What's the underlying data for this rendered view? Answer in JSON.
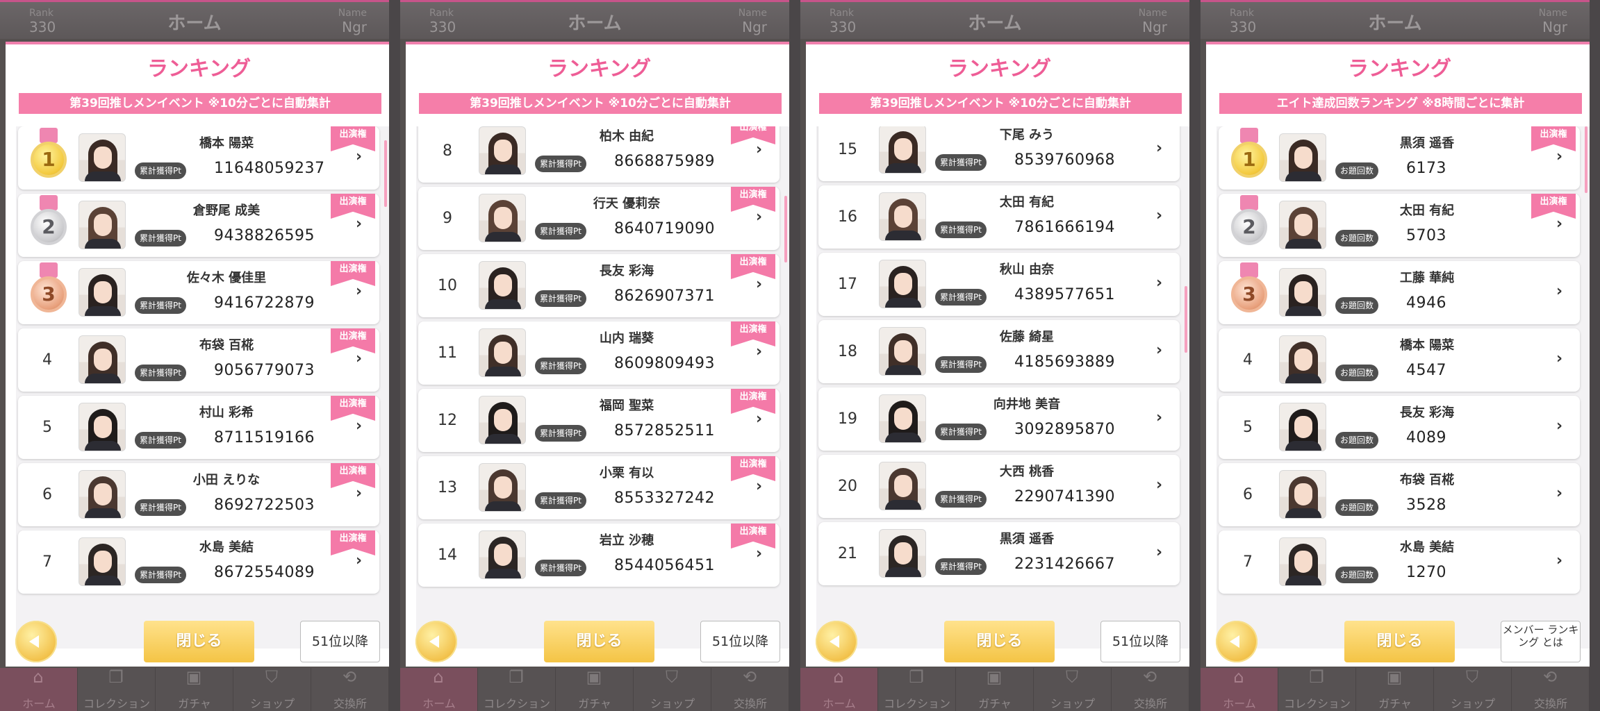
{
  "topbar": {
    "rank_label": "Rank",
    "rank_value": "330",
    "title": "ホーム",
    "name_label": "Name",
    "name_value": "Ngr"
  },
  "nav": [
    {
      "label": "ホーム",
      "icon": "home-icon",
      "glyph": "⌂"
    },
    {
      "label": "コレクション",
      "icon": "collection-icon",
      "glyph": "❐"
    },
    {
      "label": "ガチャ",
      "icon": "gacha-icon",
      "glyph": "▣"
    },
    {
      "label": "ショップ",
      "icon": "cart-icon",
      "glyph": "⛉"
    },
    {
      "label": "交換所",
      "icon": "exchange-icon",
      "glyph": "⟲"
    }
  ],
  "dialog_title": "ランキング",
  "badge_label": "出演権",
  "close_label": "閉じる",
  "panels": [
    {
      "banner": "第39回推しメンイベント ※10分ごとに自動集計",
      "pt_label": "累計獲得Pt",
      "more_label": "51位以降",
      "rows": [
        {
          "rank": "1",
          "name": "橋本 陽菜",
          "score": "11648059237",
          "badge": true
        },
        {
          "rank": "2",
          "name": "倉野尾 成美",
          "score": "9438826595",
          "badge": true
        },
        {
          "rank": "3",
          "name": "佐々木 優佳里",
          "score": "9416722879",
          "badge": true
        },
        {
          "rank": "4",
          "name": "布袋 百椛",
          "score": "9056779073",
          "badge": true
        },
        {
          "rank": "5",
          "name": "村山 彩希",
          "score": "8711519166",
          "badge": true
        },
        {
          "rank": "6",
          "name": "小田 えりな",
          "score": "8692722503",
          "badge": true
        },
        {
          "rank": "7",
          "name": "水島 美結",
          "score": "8672554089",
          "badge": true
        }
      ]
    },
    {
      "banner": "第39回推しメンイベント ※10分ごとに自動集計",
      "pt_label": "累計獲得Pt",
      "more_label": "51位以降",
      "rows": [
        {
          "rank": "8",
          "name": "柏木 由紀",
          "score": "8668875989",
          "badge": true
        },
        {
          "rank": "9",
          "name": "行天 優莉奈",
          "score": "8640719090",
          "badge": true
        },
        {
          "rank": "10",
          "name": "長友 彩海",
          "score": "8626907371",
          "badge": true
        },
        {
          "rank": "11",
          "name": "山内 瑞葵",
          "score": "8609809493",
          "badge": true
        },
        {
          "rank": "12",
          "name": "福岡 聖菜",
          "score": "8572852511",
          "badge": true
        },
        {
          "rank": "13",
          "name": "小栗 有以",
          "score": "8553327242",
          "badge": true
        },
        {
          "rank": "14",
          "name": "岩立 沙穂",
          "score": "8544056451",
          "badge": true
        }
      ]
    },
    {
      "banner": "第39回推しメンイベント ※10分ごとに自動集計",
      "pt_label": "累計獲得Pt",
      "more_label": "51位以降",
      "rows": [
        {
          "rank": "15",
          "name": "下尾 みう",
          "score": "8539760968",
          "badge": false
        },
        {
          "rank": "16",
          "name": "太田 有紀",
          "score": "7861666194",
          "badge": false
        },
        {
          "rank": "17",
          "name": "秋山 由奈",
          "score": "4389577651",
          "badge": false
        },
        {
          "rank": "18",
          "name": "佐藤 綺星",
          "score": "4185693889",
          "badge": false
        },
        {
          "rank": "19",
          "name": "向井地 美音",
          "score": "3092895870",
          "badge": false
        },
        {
          "rank": "20",
          "name": "大西 桃香",
          "score": "2290741390",
          "badge": false
        },
        {
          "rank": "21",
          "name": "黒須 遥香",
          "score": "2231426667",
          "badge": false
        }
      ]
    },
    {
      "banner": "エイト達成回数ランキング ※8時間ごとに集計",
      "pt_label": "お題回数",
      "more_label": "メンバー ランキング とは",
      "rows": [
        {
          "rank": "1",
          "name": "黒須 遥香",
          "score": "6173",
          "badge": true
        },
        {
          "rank": "2",
          "name": "太田 有紀",
          "score": "5703",
          "badge": true
        },
        {
          "rank": "3",
          "name": "工藤 華純",
          "score": "4946",
          "badge": false
        },
        {
          "rank": "4",
          "name": "橋本 陽菜",
          "score": "4547",
          "badge": false
        },
        {
          "rank": "5",
          "name": "長友 彩海",
          "score": "4089",
          "badge": false
        },
        {
          "rank": "6",
          "name": "布袋 百椛",
          "score": "3528",
          "badge": false
        },
        {
          "rank": "7",
          "name": "水島 美結",
          "score": "1270",
          "badge": false
        }
      ]
    }
  ],
  "colors": {
    "accent_pink": "#ee5d96",
    "banner_pink": "#f57ea9",
    "button_gold": "#f4c445"
  }
}
